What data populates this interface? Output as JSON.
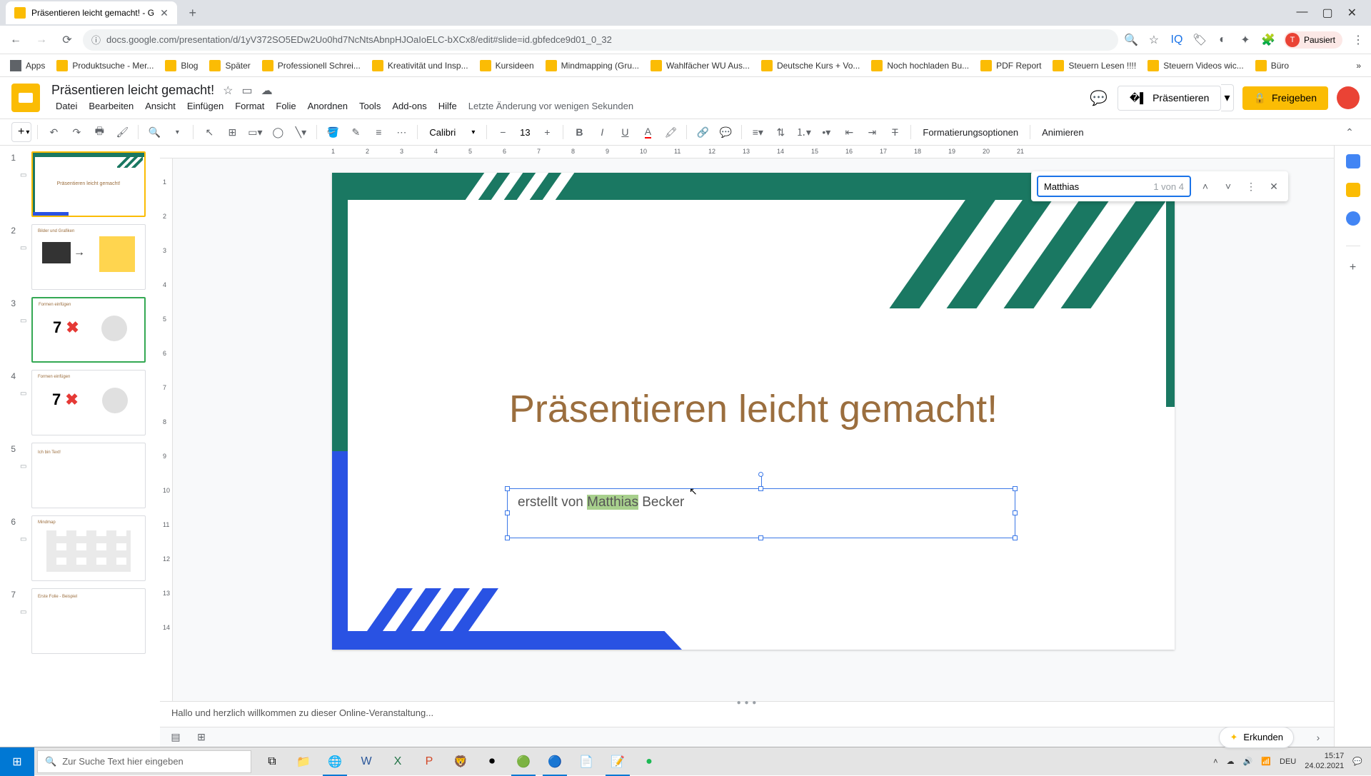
{
  "browser": {
    "tab_title": "Präsentieren leicht gemacht! - G",
    "url": "docs.google.com/presentation/d/1yV372SO5EDw2Uo0hd7NcNtsAbnpHJOaIoELC-bXCx8/edit#slide=id.gbfedce9d01_0_32",
    "profile_status": "Pausiert"
  },
  "bookmarks": {
    "apps": "Apps",
    "items": [
      "Produktsuche - Mer...",
      "Blog",
      "Später",
      "Professionell Schrei...",
      "Kreativität und Insp...",
      "Kursideen",
      "Mindmapping  (Gru...",
      "Wahlfächer WU Aus...",
      "Deutsche Kurs + Vo...",
      "Noch hochladen Bu...",
      "PDF Report",
      "Steuern Lesen !!!!",
      "Steuern Videos wic...",
      "Büro"
    ]
  },
  "doc": {
    "title": "Präsentieren leicht gemacht!",
    "menus": [
      "Datei",
      "Bearbeiten",
      "Ansicht",
      "Einfügen",
      "Format",
      "Folie",
      "Anordnen",
      "Tools",
      "Add-ons",
      "Hilfe"
    ],
    "last_edit": "Letzte Änderung vor wenigen Sekunden",
    "present": "Präsentieren",
    "share": "Freigeben"
  },
  "toolbar": {
    "font": "Calibri",
    "font_size": "13",
    "format_opts": "Formatierungsoptionen",
    "animate": "Animieren"
  },
  "find": {
    "query": "Matthias",
    "count": "1 von 4"
  },
  "slide": {
    "title": "Präsentieren leicht gemacht!",
    "subtitle_prefix": "erstellt von ",
    "subtitle_highlight": "Matthias",
    "subtitle_suffix": " Becker"
  },
  "thumbs": {
    "t2_label": "Bilder und Grafiken",
    "t3_label": "Formen einfügen",
    "t3_big": "7",
    "t4_label": "Formen einfügen",
    "t5_label": "Ich bin Text!",
    "t6_label": "Mindmap",
    "t7_label": "Erste Folie - Beispiel"
  },
  "notes": "Hallo und herzlich willkommen zu dieser Online-Veranstaltung...",
  "explore": "Erkunden",
  "taskbar": {
    "search_placeholder": "Zur Suche Text hier eingeben",
    "lang": "DEU",
    "time": "15:17",
    "date": "24.02.2021"
  },
  "ruler_h": [
    "1",
    "2",
    "3",
    "4",
    "5",
    "6",
    "7",
    "8",
    "9",
    "10",
    "11",
    "12",
    "13",
    "14",
    "15",
    "16",
    "17",
    "18",
    "19",
    "20",
    "21"
  ],
  "ruler_v": [
    "1",
    "2",
    "3",
    "4",
    "5",
    "6",
    "7",
    "8",
    "9",
    "10",
    "11",
    "12",
    "13",
    "14"
  ]
}
